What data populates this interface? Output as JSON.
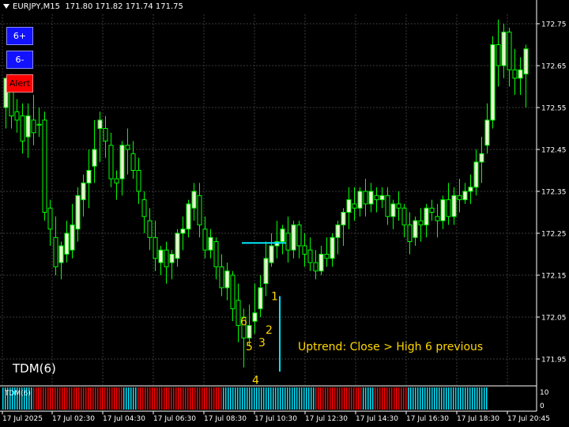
{
  "header": {
    "symbol_timeframe": "EURJPY,M15",
    "ohlc": "171.80 171.82 171.74 171.75"
  },
  "buttons": {
    "plus_label": "6+",
    "minus_label": "6-",
    "alert_label": "Alert"
  },
  "colors": {
    "background": "#000000",
    "grid": "#3a3a3a",
    "axis": "#ffffff",
    "bull_fill": "#f0f0d8",
    "wick": "#00ff00",
    "bear_fill": "#000000",
    "cyan": "#00e5ff",
    "yellow": "#ffd700",
    "tdm_red": "#ff0000",
    "tdm_cyan": "#00e5ff",
    "button_blue": "#1212ff",
    "button_red": "#ff0000"
  },
  "chart_data": {
    "type": "candlestick",
    "price_axis": {
      "ticks": [
        "172.75",
        "172.65",
        "172.55",
        "172.45",
        "172.35",
        "172.25",
        "172.15",
        "172.05",
        "171.95"
      ],
      "ylim": [
        171.91,
        172.81
      ]
    },
    "time_axis": {
      "labels": [
        "17 Jul 2025",
        "17 Jul 02:30",
        "17 Jul 04:30",
        "17 Jul 06:30",
        "17 Jul 08:30",
        "17 Jul 10:30",
        "17 Jul 12:30",
        "17 Jul 14:30",
        "17 Jul 16:30",
        "17 Jul 18:30",
        "17 Jul 20:45"
      ]
    },
    "candles": [
      {
        "o": 172.55,
        "h": 172.6,
        "c": 172.62,
        "l": 172.5
      },
      {
        "o": 172.6,
        "h": 172.63,
        "c": 172.53,
        "l": 172.5
      },
      {
        "o": 172.54,
        "h": 172.57,
        "c": 172.52,
        "l": 172.49
      },
      {
        "o": 172.53,
        "h": 172.56,
        "c": 172.47,
        "l": 172.44
      },
      {
        "o": 172.48,
        "h": 172.56,
        "c": 172.53,
        "l": 172.43
      },
      {
        "o": 172.52,
        "h": 172.58,
        "c": 172.49,
        "l": 172.46
      },
      {
        "o": 172.51,
        "h": 172.55,
        "c": 172.51,
        "l": 172.48
      },
      {
        "o": 172.52,
        "h": 172.54,
        "c": 172.3,
        "l": 172.28
      },
      {
        "o": 172.31,
        "h": 172.33,
        "c": 172.26,
        "l": 172.22
      },
      {
        "o": 172.24,
        "h": 172.29,
        "c": 172.17,
        "l": 172.15
      },
      {
        "o": 172.18,
        "h": 172.23,
        "c": 172.22,
        "l": 172.14
      },
      {
        "o": 172.2,
        "h": 172.28,
        "c": 172.25,
        "l": 172.18
      },
      {
        "o": 172.21,
        "h": 172.32,
        "c": 172.27,
        "l": 172.19
      },
      {
        "o": 172.26,
        "h": 172.36,
        "c": 172.34,
        "l": 172.23
      },
      {
        "o": 172.33,
        "h": 172.39,
        "c": 172.37,
        "l": 172.29
      },
      {
        "o": 172.37,
        "h": 172.45,
        "c": 172.4,
        "l": 172.31
      },
      {
        "o": 172.41,
        "h": 172.52,
        "c": 172.45,
        "l": 172.37
      },
      {
        "o": 172.5,
        "h": 172.54,
        "c": 172.52,
        "l": 172.42
      },
      {
        "o": 172.5,
        "h": 172.53,
        "c": 172.47,
        "l": 172.43
      },
      {
        "o": 172.46,
        "h": 172.49,
        "c": 172.38,
        "l": 172.36
      },
      {
        "o": 172.38,
        "h": 172.4,
        "c": 172.37,
        "l": 172.33
      },
      {
        "o": 172.38,
        "h": 172.47,
        "c": 172.46,
        "l": 172.34
      },
      {
        "o": 172.46,
        "h": 172.5,
        "c": 172.45,
        "l": 172.39
      },
      {
        "o": 172.44,
        "h": 172.47,
        "c": 172.4,
        "l": 172.38
      },
      {
        "o": 172.4,
        "h": 172.43,
        "c": 172.35,
        "l": 172.32
      },
      {
        "o": 172.33,
        "h": 172.35,
        "c": 172.29,
        "l": 172.25
      },
      {
        "o": 172.28,
        "h": 172.31,
        "c": 172.24,
        "l": 172.21
      },
      {
        "o": 172.24,
        "h": 172.28,
        "c": 172.19,
        "l": 172.16
      },
      {
        "o": 172.18,
        "h": 172.22,
        "c": 172.21,
        "l": 172.15
      },
      {
        "o": 172.21,
        "h": 172.23,
        "c": 172.17,
        "l": 172.13
      },
      {
        "o": 172.18,
        "h": 172.21,
        "c": 172.2,
        "l": 172.14
      },
      {
        "o": 172.19,
        "h": 172.26,
        "c": 172.25,
        "l": 172.17
      },
      {
        "o": 172.25,
        "h": 172.29,
        "c": 172.26,
        "l": 172.21
      },
      {
        "o": 172.26,
        "h": 172.33,
        "c": 172.32,
        "l": 172.24
      },
      {
        "o": 172.31,
        "h": 172.37,
        "c": 172.35,
        "l": 172.28
      },
      {
        "o": 172.34,
        "h": 172.37,
        "c": 172.27,
        "l": 172.24
      },
      {
        "o": 172.26,
        "h": 172.29,
        "c": 172.21,
        "l": 172.19
      },
      {
        "o": 172.21,
        "h": 172.26,
        "c": 172.24,
        "l": 172.19
      },
      {
        "o": 172.23,
        "h": 172.24,
        "c": 172.17,
        "l": 172.14
      },
      {
        "o": 172.17,
        "h": 172.2,
        "c": 172.12,
        "l": 172.1
      },
      {
        "o": 172.12,
        "h": 172.18,
        "c": 172.16,
        "l": 172.09
      },
      {
        "o": 172.15,
        "h": 172.16,
        "c": 172.07,
        "l": 172.04
      },
      {
        "o": 172.09,
        "h": 172.13,
        "c": 172.03,
        "l": 171.99
      },
      {
        "o": 172.05,
        "h": 172.07,
        "c": 172.0,
        "l": 171.93
      },
      {
        "o": 172.0,
        "h": 172.08,
        "c": 172.03,
        "l": 171.98
      },
      {
        "o": 172.04,
        "h": 172.13,
        "c": 172.06,
        "l": 172.01
      },
      {
        "o": 172.07,
        "h": 172.15,
        "c": 172.12,
        "l": 172.05
      },
      {
        "o": 172.13,
        "h": 172.23,
        "c": 172.19,
        "l": 172.1
      },
      {
        "o": 172.18,
        "h": 172.25,
        "c": 172.22,
        "l": 172.17
      },
      {
        "o": 172.22,
        "h": 172.28,
        "c": 172.23,
        "l": 172.19
      },
      {
        "o": 172.23,
        "h": 172.27,
        "c": 172.26,
        "l": 172.2
      },
      {
        "o": 172.25,
        "h": 172.29,
        "c": 172.21,
        "l": 172.18
      },
      {
        "o": 172.21,
        "h": 172.28,
        "c": 172.27,
        "l": 172.19
      },
      {
        "o": 172.27,
        "h": 172.28,
        "c": 172.22,
        "l": 172.19
      },
      {
        "o": 172.22,
        "h": 172.25,
        "c": 172.2,
        "l": 172.17
      },
      {
        "o": 172.21,
        "h": 172.24,
        "c": 172.18,
        "l": 172.16
      },
      {
        "o": 172.18,
        "h": 172.21,
        "c": 172.16,
        "l": 172.14
      },
      {
        "o": 172.16,
        "h": 172.22,
        "c": 172.2,
        "l": 172.15
      },
      {
        "o": 172.2,
        "h": 172.24,
        "c": 172.19,
        "l": 172.17
      },
      {
        "o": 172.19,
        "h": 172.25,
        "c": 172.24,
        "l": 172.17
      },
      {
        "o": 172.24,
        "h": 172.28,
        "c": 172.27,
        "l": 172.2
      },
      {
        "o": 172.27,
        "h": 172.31,
        "c": 172.3,
        "l": 172.22
      },
      {
        "o": 172.3,
        "h": 172.36,
        "c": 172.33,
        "l": 172.26
      },
      {
        "o": 172.32,
        "h": 172.36,
        "c": 172.31,
        "l": 172.28
      },
      {
        "o": 172.31,
        "h": 172.36,
        "c": 172.35,
        "l": 172.29
      },
      {
        "o": 172.35,
        "h": 172.38,
        "c": 172.32,
        "l": 172.29
      },
      {
        "o": 172.32,
        "h": 172.37,
        "c": 172.35,
        "l": 172.3
      },
      {
        "o": 172.34,
        "h": 172.36,
        "c": 172.33,
        "l": 172.3
      },
      {
        "o": 172.33,
        "h": 172.36,
        "c": 172.34,
        "l": 172.31
      },
      {
        "o": 172.34,
        "h": 172.36,
        "c": 172.29,
        "l": 172.27
      },
      {
        "o": 172.29,
        "h": 172.33,
        "c": 172.32,
        "l": 172.26
      },
      {
        "o": 172.32,
        "h": 172.35,
        "c": 172.31,
        "l": 172.28
      },
      {
        "o": 172.31,
        "h": 172.32,
        "c": 172.27,
        "l": 172.24
      },
      {
        "o": 172.27,
        "h": 172.3,
        "c": 172.23,
        "l": 172.2
      },
      {
        "o": 172.24,
        "h": 172.29,
        "c": 172.28,
        "l": 172.22
      },
      {
        "o": 172.28,
        "h": 172.31,
        "c": 172.27,
        "l": 172.23
      },
      {
        "o": 172.27,
        "h": 172.32,
        "c": 172.31,
        "l": 172.24
      },
      {
        "o": 172.31,
        "h": 172.33,
        "c": 172.3,
        "l": 172.28
      },
      {
        "o": 172.29,
        "h": 172.32,
        "c": 172.28,
        "l": 172.24
      },
      {
        "o": 172.28,
        "h": 172.34,
        "c": 172.33,
        "l": 172.26
      },
      {
        "o": 172.33,
        "h": 172.37,
        "c": 172.29,
        "l": 172.27
      },
      {
        "o": 172.29,
        "h": 172.36,
        "c": 172.34,
        "l": 172.27
      },
      {
        "o": 172.34,
        "h": 172.38,
        "c": 172.33,
        "l": 172.3
      },
      {
        "o": 172.33,
        "h": 172.37,
        "c": 172.35,
        "l": 172.32
      },
      {
        "o": 172.35,
        "h": 172.39,
        "c": 172.36,
        "l": 172.32
      },
      {
        "o": 172.36,
        "h": 172.45,
        "c": 172.42,
        "l": 172.34
      },
      {
        "o": 172.42,
        "h": 172.48,
        "c": 172.44,
        "l": 172.37
      },
      {
        "o": 172.46,
        "h": 172.56,
        "c": 172.52,
        "l": 172.44
      },
      {
        "o": 172.52,
        "h": 172.72,
        "c": 172.7,
        "l": 172.5
      },
      {
        "o": 172.7,
        "h": 172.76,
        "c": 172.65,
        "l": 172.6
      },
      {
        "o": 172.65,
        "h": 172.75,
        "c": 172.73,
        "l": 172.62
      },
      {
        "o": 172.73,
        "h": 172.74,
        "c": 172.64,
        "l": 172.6
      },
      {
        "o": 172.64,
        "h": 172.69,
        "c": 172.62,
        "l": 172.58
      },
      {
        "o": 172.62,
        "h": 172.67,
        "c": 172.64,
        "l": 172.58
      },
      {
        "o": 172.63,
        "h": 172.7,
        "c": 172.69,
        "l": 172.55
      }
    ],
    "resistance_line": {
      "price": 172.227
    },
    "signal_line": {
      "top_price": 172.1,
      "bottom_price": 171.92
    },
    "tdm_counts": [
      {
        "label": "6",
        "price": 172.04
      },
      {
        "label": "5",
        "price": 171.98
      },
      {
        "label": "4",
        "price": 171.9
      },
      {
        "label": "3",
        "price": 171.99
      },
      {
        "label": "2",
        "price": 172.02
      },
      {
        "label": "1",
        "price": 172.1
      }
    ],
    "annotation": "Uptrend: Close > High 6 previous",
    "indicator_label": "TDM(6)",
    "sub_window": {
      "label": "TDM(6)",
      "scale_labels": [
        "10",
        "0"
      ],
      "segments": [
        {
          "color": "cyan",
          "bars": 13
        },
        {
          "color": "red",
          "bars": 38
        },
        {
          "color": "cyan",
          "bars": 6
        },
        {
          "color": "red",
          "bars": 36
        },
        {
          "color": "cyan",
          "bars": 39
        },
        {
          "color": "red",
          "bars": 20
        },
        {
          "color": "cyan",
          "bars": 5
        },
        {
          "color": "red",
          "bars": 14
        },
        {
          "color": "cyan",
          "bars": 34
        }
      ]
    }
  }
}
